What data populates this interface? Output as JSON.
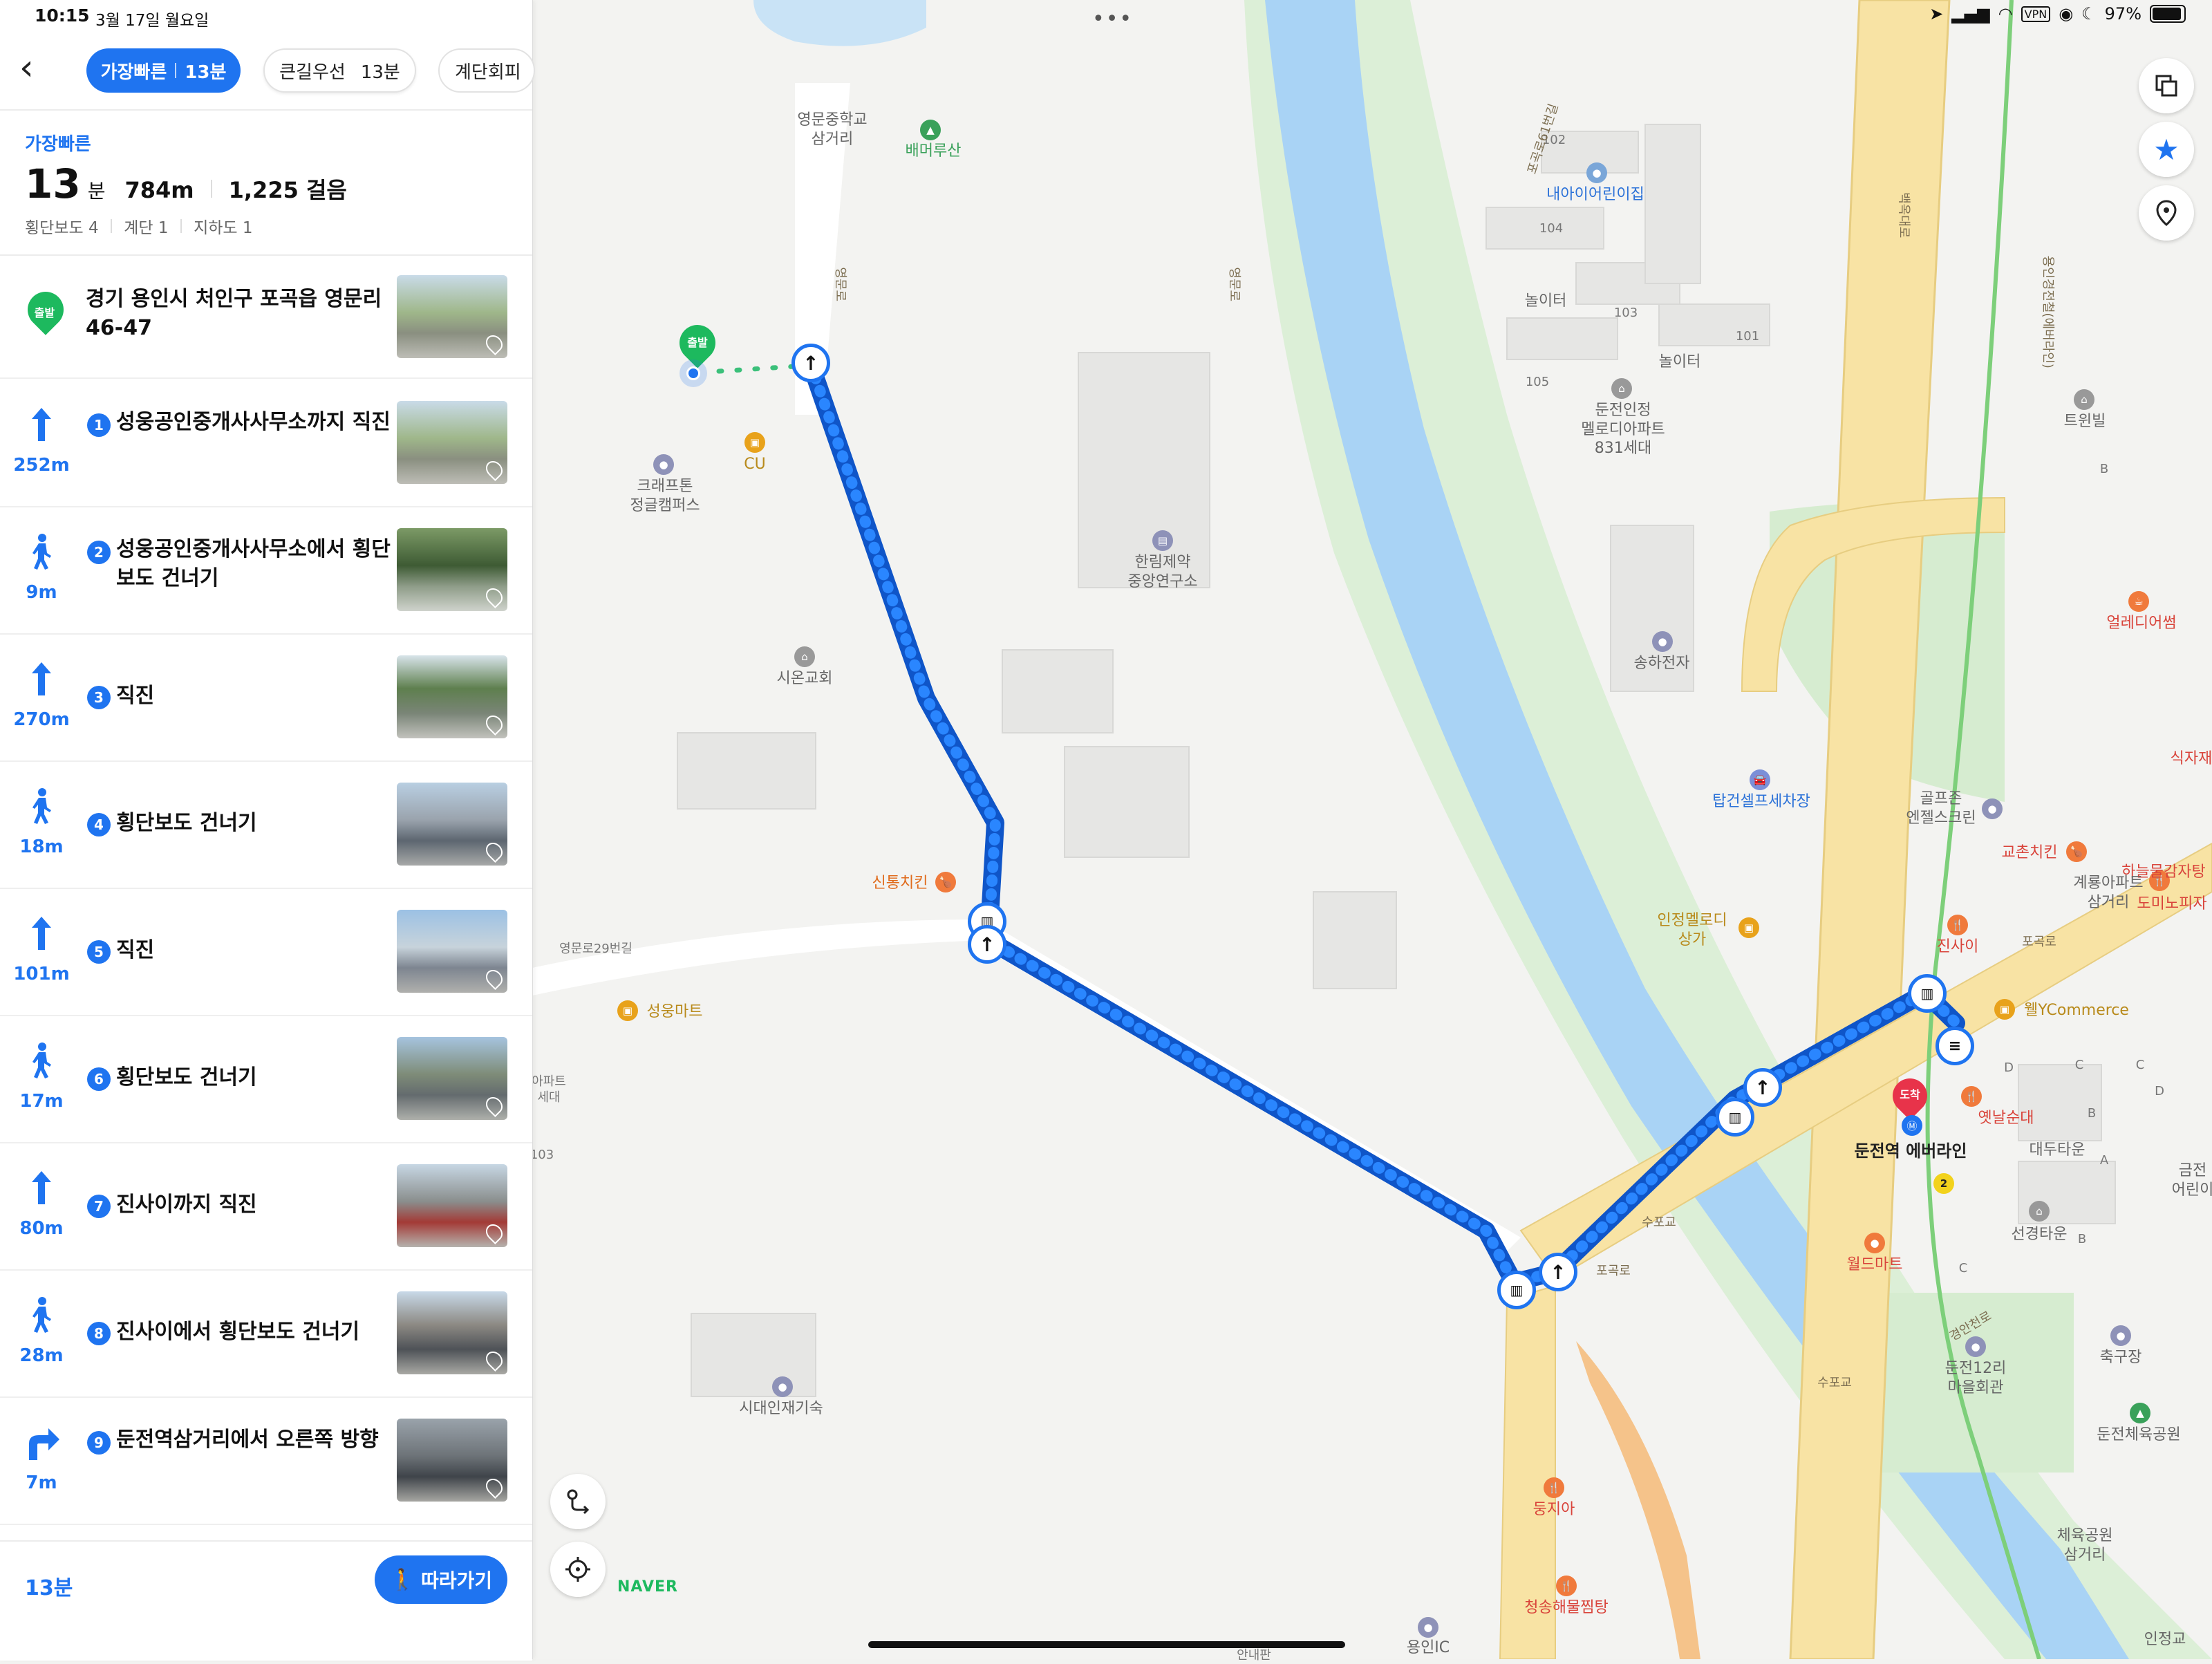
{
  "status": {
    "time": "10:15",
    "date": "3월 17일 월요일",
    "battery": "97%",
    "vpn": "VPN"
  },
  "route_tabs": [
    {
      "label": "가장빠른",
      "time": "13분",
      "active": true
    },
    {
      "label": "큰길우선",
      "time": "13분",
      "active": false
    },
    {
      "label": "계단회피",
      "time": "",
      "active": false
    }
  ],
  "summary": {
    "title": "가장빠른",
    "minutes": "13",
    "minutes_unit": "분",
    "distance": "784m",
    "steps": "1,225 걸음",
    "crosswalk": "횡단보도 4",
    "stairs": "계단 1",
    "underpass": "지하도 1"
  },
  "start": {
    "badge": "출발",
    "address": "경기 용인시 처인구 포곡읍 영문리 46-47"
  },
  "steps": [
    {
      "num": "1",
      "icon": "arrow-up-icon",
      "distance": "252m",
      "text": "성웅공인중개사사무소까지 직진"
    },
    {
      "num": "2",
      "icon": "pedestrian-icon",
      "distance": "9m",
      "text": "성웅공인중개사사무소에서 횡단보도 건너기"
    },
    {
      "num": "3",
      "icon": "arrow-up-icon",
      "distance": "270m",
      "text": "직진"
    },
    {
      "num": "4",
      "icon": "pedestrian-icon",
      "distance": "18m",
      "text": "횡단보도 건너기"
    },
    {
      "num": "5",
      "icon": "arrow-up-icon",
      "distance": "101m",
      "text": "직진"
    },
    {
      "num": "6",
      "icon": "pedestrian-icon",
      "distance": "17m",
      "text": "횡단보도 건너기"
    },
    {
      "num": "7",
      "icon": "arrow-up-icon",
      "distance": "80m",
      "text": "진사이까지 직진"
    },
    {
      "num": "8",
      "icon": "pedestrian-icon",
      "distance": "28m",
      "text": "진사이에서 횡단보도 건너기"
    },
    {
      "num": "9",
      "icon": "turn-right-icon",
      "distance": "7m",
      "text": "둔전역삼거리에서 오른쪽 방향"
    }
  ],
  "bottom": {
    "total_time": "13분",
    "follow_label": "따라가기"
  },
  "map": {
    "brand": "NAVER",
    "start_marker": "출발",
    "end_marker": "도착",
    "labels": {
      "youngmun_jhs": "영문중학교\n삼거리",
      "baemeorusan": "배머루산",
      "naeai_daycare": "내아이어린이집",
      "apt_102": "102",
      "apt_104": "104",
      "apt_103": "103",
      "apt_101": "101",
      "apt_105": "105",
      "playground1": "놀이터",
      "playground2": "놀이터",
      "dunjeon_melody": "둔전인정\n멜로디아파트\n831세대",
      "twinvil": "트윈빌",
      "b_label1": "B",
      "craftone": "크래프톤\n정글캠퍼스",
      "cu": "CU",
      "hanlim": "한림제약\n중앙연구소",
      "songha": "송하전자",
      "sion": "시온교회",
      "tapgun": "탑건셀프세차장",
      "golfzone": "골프존\n엔젤스크린",
      "kyochon": "교촌치킨",
      "hanultop": "하늘물감자탕",
      "gyeryong": "계룡아파트\n삼거리",
      "jinsai": "진사이",
      "domino": "도미노피자",
      "sintong": "신통치킨",
      "injeong_sangga": "인정멜로디\n상가",
      "youngmunro29": "영문로29번길",
      "seongung": "성웅마트",
      "apt_left": "아파트\n세대",
      "num_103": "103",
      "welycommerce": "웰YCommerce",
      "yetnal": "옛날순대",
      "dunjeon_station": "둔전역 에버라인",
      "daedoo": "대두타운",
      "seongyeong": "선경타운",
      "worldmart": "월드마트",
      "supogyo1": "수포교",
      "supogyo2": "수포교",
      "pogokro": "포곡로",
      "pogokro2": "포곡로",
      "sidae": "시대인재기숙",
      "dunjeon12": "둔전12리\n마을회관",
      "soccer": "축구장",
      "dunjeon_sports": "둔전체육공원",
      "sports_junction": "체육공원\n삼거리",
      "dungji": "둥지아",
      "cheongsong": "청송해물찜탕",
      "yonginic": "용인IC",
      "injeonggyo": "인정교",
      "eldisum": "얼레디어썸",
      "sikjaje": "식자재",
      "geumjeon": "금전\n어린이",
      "pogokro61": "포곡로61번길",
      "youngmunro": "영문로",
      "youngmunro2": "영문로",
      "baekokdaero": "백옥대로",
      "yonginlightrail": "용인경전철(에버라인)",
      "jungsunro": "경안천로",
      "anaepan": "안내판",
      "letter_b2": "B",
      "letter_c": "C",
      "letter_d": "D",
      "letter_a": "A",
      "letter_c2": "C",
      "letter_b3": "B",
      "letter_c3": "C",
      "letter_d2": "D",
      "exit2": "2"
    }
  },
  "colors": {
    "accent": "#1f74f0",
    "route": "#1a6ff0",
    "river": "#a9d3f5",
    "greenbelt": "#d6ecd0",
    "highway": "#f8e3a4",
    "start_green": "#1db95e",
    "end_red": "#e8334a"
  }
}
